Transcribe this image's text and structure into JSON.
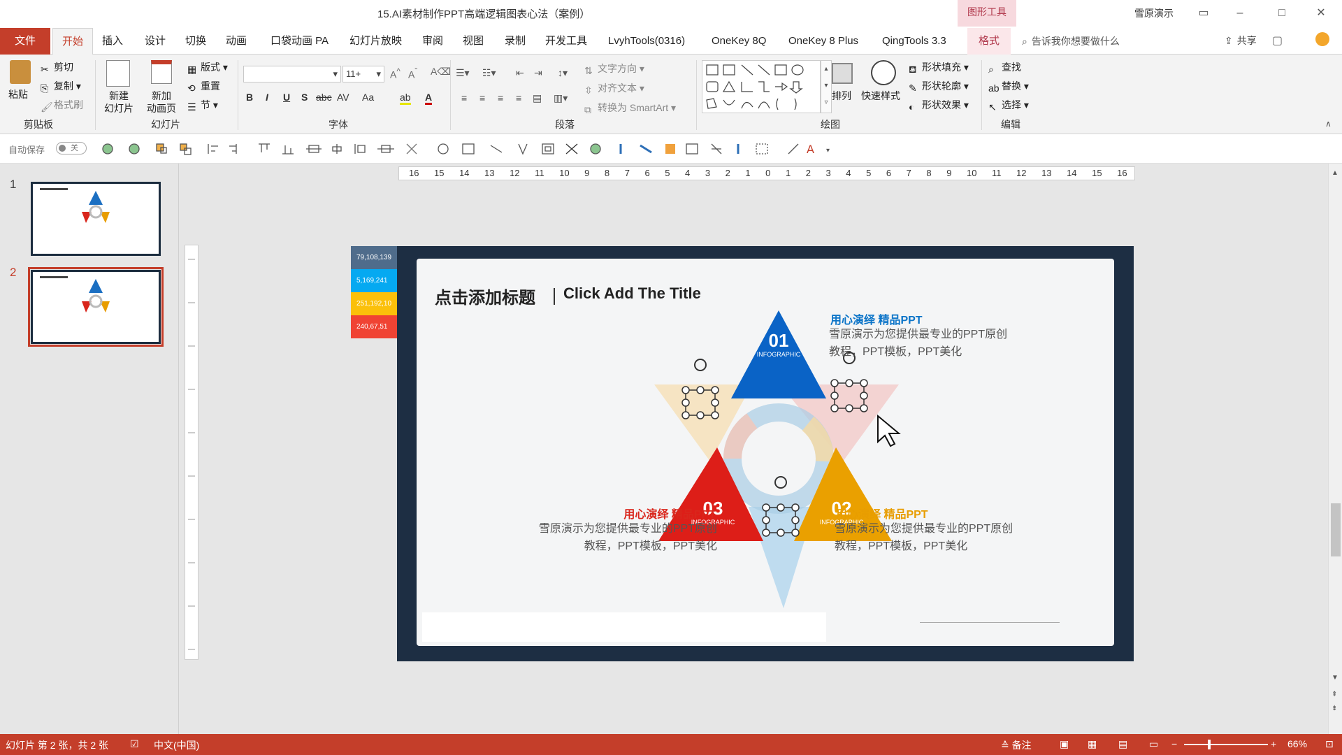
{
  "app": {
    "doc_title": "15.AI素材制作PPT高端逻辑图表心法（案例）",
    "drawing_tools": "图形工具",
    "user": "雪原演示"
  },
  "menu": {
    "tabs": [
      "文件",
      "开始",
      "插入",
      "设计",
      "切换",
      "动画",
      "口袋动画 PA",
      "幻灯片放映",
      "审阅",
      "视图",
      "录制",
      "开发工具",
      "LvyhTools(0316)",
      "OneKey 8Q",
      "OneKey 8 Plus",
      "QingTools 3.3",
      "格式"
    ],
    "tell_me": "告诉我你想要做什么",
    "share": "共享"
  },
  "ribbon": {
    "clipboard": {
      "paste": "粘贴",
      "cut": "剪切",
      "copy": "复制",
      "format_painter": "格式刷",
      "label": "剪贴板"
    },
    "slides": {
      "new_slide": "新建\n幻灯片",
      "new_anim": "新加\n动画页",
      "layout": "版式",
      "reset": "重置",
      "section": "节",
      "label": "幻灯片"
    },
    "font": {
      "size": "11+",
      "label": "字体",
      "buttons": [
        "B",
        "I",
        "U",
        "S",
        "abc",
        "AV",
        "Aa",
        "A"
      ]
    },
    "paragraph": {
      "text_direction": "文字方向",
      "align_text": "对齐文本",
      "smartart": "转换为 SmartArt",
      "label": "段落"
    },
    "drawing": {
      "arrange": "排列",
      "quick_styles": "快速样式",
      "fill": "形状填充",
      "outline": "形状轮廓",
      "effects": "形状效果",
      "label": "绘图"
    },
    "editing": {
      "find": "查找",
      "replace": "替换",
      "select": "选择",
      "label": "编辑"
    }
  },
  "qat": {
    "autosave": "自动保存",
    "toggle": "关"
  },
  "thumbnails": [
    {
      "num": "1"
    },
    {
      "num": "2"
    }
  ],
  "ruler": {
    "ticks": [
      "16",
      "15",
      "14",
      "13",
      "12",
      "11",
      "10",
      "9",
      "8",
      "7",
      "6",
      "5",
      "4",
      "3",
      "2",
      "1",
      "0",
      "1",
      "2",
      "3",
      "4",
      "5",
      "6",
      "7",
      "8",
      "9",
      "10",
      "11",
      "12",
      "13",
      "14",
      "15",
      "16"
    ]
  },
  "swatches": [
    {
      "label": "79,108,139",
      "color": "#4f6c8b"
    },
    {
      "label": "5,169,241",
      "color": "#05a9f1"
    },
    {
      "label": "251,192,10",
      "color": "#fbc00a"
    },
    {
      "label": "240,67,51",
      "color": "#f04333"
    }
  ],
  "slide": {
    "title": "点击添加标题",
    "subtitle": "Click Add The Title",
    "items": [
      {
        "num": "01",
        "tag": "INFOGRAPHIC",
        "title": "用心演绎 精品PPT",
        "body": "雪原演示为您提供最专业的PPT原创教程，PPT模板，PPT美化",
        "color": "#0b74c8"
      },
      {
        "num": "02",
        "tag": "INFOGRAPHIC",
        "title": "用心演绎 精品PPT",
        "body": "雪原演示为您提供最专业的PPT原创教程，PPT模板，PPT美化",
        "color": "#e89d00"
      },
      {
        "num": "03",
        "tag": "INFOGRAPHIC",
        "title": "用心演绎 精品PPT",
        "body": "雪原演示为您提供最专业的PPT原创教程，PPT模板，PPT美化",
        "color": "#d9261c"
      }
    ]
  },
  "status": {
    "slide_info": "幻灯片 第 2 张，共 2 张",
    "language": "中文(中国)",
    "notes": "备注",
    "zoom": "66%"
  }
}
